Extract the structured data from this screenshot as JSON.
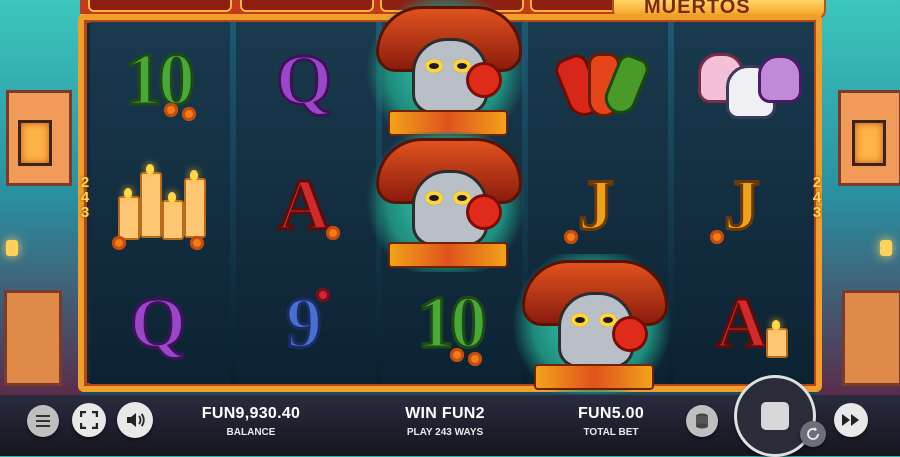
{
  "game": {
    "title_fragment": "MUERTOS",
    "ways_count_side": "243"
  },
  "reels": [
    [
      "ten-symbol",
      "candles-symbol",
      "queen-symbol"
    ],
    [
      "queen-symbol",
      "ace-symbol",
      "nine-symbol"
    ],
    [
      "wild-skull-symbol",
      "wild-skull-symbol",
      "ten-symbol"
    ],
    [
      "chili-symbol",
      "jack-symbol",
      "wild-skull-symbol"
    ],
    [
      "sugar-skulls-symbol",
      "jack-symbol",
      "ace-symbol"
    ]
  ],
  "symbols": {
    "ten": "10",
    "queen": "Q",
    "ace": "A",
    "nine": "9",
    "jack": "J"
  },
  "hud": {
    "balance_value": "FUN9,930.40",
    "balance_label": "BALANCE",
    "win_value": "WIN FUN2",
    "ways_label": "PLAY 243 WAYS",
    "bet_value": "FUN5.00",
    "bet_label": "TOTAL BET"
  },
  "icons": {
    "menu": "menu-icon",
    "fullscreen": "fullscreen-icon",
    "sound": "sound-icon",
    "coins": "coins-icon",
    "spin": "stop-icon",
    "autoplay": "autoplay-icon",
    "turbo": "fast-forward-icon"
  },
  "colors": {
    "frame": "#f0a02a",
    "reel_bg": "#0f2a3a",
    "bar_bg": "#1f2030"
  }
}
